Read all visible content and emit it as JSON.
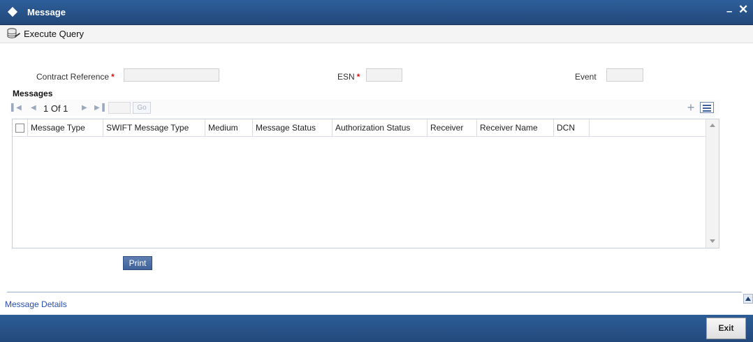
{
  "window": {
    "title": "Message",
    "minimize_label": "–",
    "close_label": "✕"
  },
  "toolbar": {
    "execute_query_label": "Execute Query"
  },
  "form": {
    "contract_reference_label": "Contract Reference",
    "esn_label": "ESN",
    "event_label": "Event",
    "required_marker": "*",
    "contract_reference_value": "",
    "esn_value": "",
    "event_value": ""
  },
  "messages": {
    "section_title": "Messages",
    "pager": {
      "page_text": "1 Of 1",
      "go_label": "Go",
      "page_input": ""
    },
    "columns": [
      "Message Type",
      "SWIFT Message Type",
      "Medium",
      "Message Status",
      "Authorization Status",
      "Receiver",
      "Receiver Name",
      "DCN"
    ],
    "rows": []
  },
  "print_label": "Print",
  "message_details_label": "Message Details",
  "exit_label": "Exit",
  "colors": {
    "title_bar": "#2e5f9a",
    "footer": "#2d5d97",
    "required": "#d11111",
    "link": "#2b4fb0"
  },
  "icons": [
    "diamond-icon",
    "execute-query-icon",
    "first-page-icon",
    "prev-page-icon",
    "next-page-icon",
    "last-page-icon",
    "add-row-icon",
    "multi-view-icon",
    "collapse-icon"
  ]
}
